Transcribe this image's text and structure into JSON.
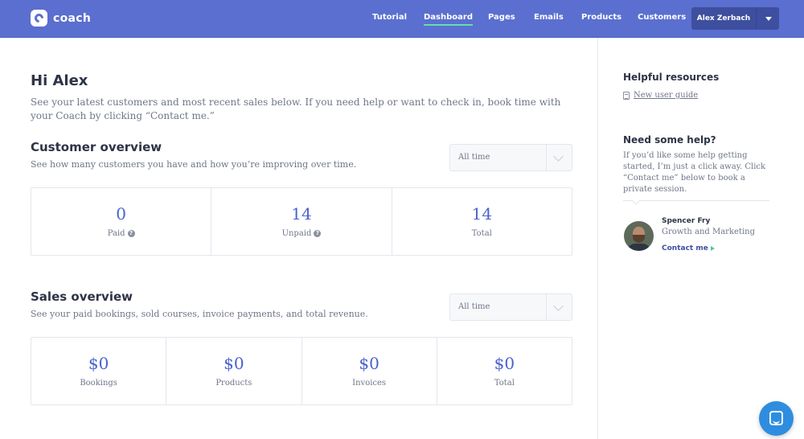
{
  "app": {
    "logo_text": "coach"
  },
  "nav": {
    "items": [
      {
        "label": "Tutorial",
        "active": false
      },
      {
        "label": "Dashboard",
        "active": true
      },
      {
        "label": "Pages",
        "active": false
      },
      {
        "label": "Emails",
        "active": false
      },
      {
        "label": "Products",
        "active": false
      },
      {
        "label": "Customers",
        "active": false
      }
    ],
    "user_name": "Alex Zerbach"
  },
  "main": {
    "greeting": "Hi Alex",
    "intro": "See your latest customers and most recent sales below. If you need help or want to check in, book time with your Coach by clicking “Contact me.”",
    "customer_overview": {
      "title": "Customer overview",
      "subtitle": "See how many customers you have and how you’re improving over time.",
      "filter": "All time",
      "stats": [
        {
          "value": "0",
          "label": "Paid",
          "help": true
        },
        {
          "value": "14",
          "label": "Unpaid",
          "help": true
        },
        {
          "value": "14",
          "label": "Total",
          "help": false
        }
      ]
    },
    "sales_overview": {
      "title": "Sales overview",
      "subtitle": "See your paid bookings, sold courses, invoice payments, and total revenue.",
      "filter": "All time",
      "stats": [
        {
          "value": "$0",
          "label": "Bookings"
        },
        {
          "value": "$0",
          "label": "Products"
        },
        {
          "value": "$0",
          "label": "Invoices"
        },
        {
          "value": "$0",
          "label": "Total"
        }
      ]
    }
  },
  "sidebar": {
    "resources_title": "Helpful resources",
    "guide_link": "New user guide",
    "help_title": "Need some help?",
    "help_text": "If you’d like some help getting started, I’m just a click away. Click “Contact me” below to book a private session.",
    "coach": {
      "name": "Spencer Fry",
      "role": "Growth and Marketing",
      "contact_label": "Contact me"
    }
  },
  "colors": {
    "brand": "#5a6fcf",
    "accent_underline": "#5fe0b0",
    "stat_value": "#4a63cc",
    "chat_button": "#2f8ddf"
  }
}
